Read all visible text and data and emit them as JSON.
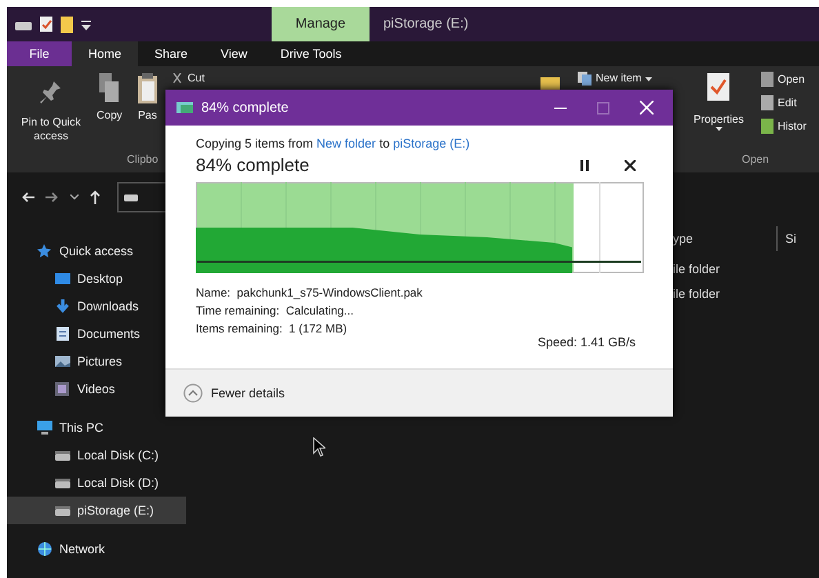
{
  "window": {
    "title": "piStorage (E:)",
    "context_tab": "Manage"
  },
  "ribbon_tabs": [
    {
      "label": "File",
      "kind": "file",
      "selected": false
    },
    {
      "label": "Home",
      "kind": "tab",
      "selected": true
    },
    {
      "label": "Share",
      "kind": "tab",
      "selected": false
    },
    {
      "label": "View",
      "kind": "tab",
      "selected": false
    },
    {
      "label": "Drive Tools",
      "kind": "tab",
      "selected": false
    }
  ],
  "ribbon": {
    "clipboard_buttons": [
      "Pin to Quick access",
      "Copy",
      "Pas"
    ],
    "cut": "Cut",
    "clipboard_group": "Clipbo",
    "new_item": "New item",
    "properties": "Properties",
    "open_items": [
      "Open",
      "Edit",
      "Histor"
    ],
    "open_group": "Open"
  },
  "sidebar": {
    "items": [
      {
        "label": "Quick access",
        "kind": "star",
        "selected": false,
        "children": [
          {
            "label": "Desktop",
            "kind": "desktop",
            "selected": false
          },
          {
            "label": "Downloads",
            "kind": "download",
            "selected": false
          },
          {
            "label": "Documents",
            "kind": "document",
            "selected": false
          },
          {
            "label": "Pictures",
            "kind": "picture",
            "selected": false
          },
          {
            "label": "Videos",
            "kind": "video",
            "selected": false
          }
        ]
      },
      {
        "label": "This PC",
        "kind": "pc",
        "selected": false,
        "children": [
          {
            "label": "Local Disk (C:)",
            "kind": "drive",
            "selected": false
          },
          {
            "label": "Local Disk (D:)",
            "kind": "drive",
            "selected": false
          },
          {
            "label": "piStorage (E:)",
            "kind": "drive",
            "selected": true
          }
        ]
      },
      {
        "label": "Network",
        "kind": "network",
        "selected": false
      }
    ]
  },
  "content": {
    "columns": [
      "ype",
      "Si"
    ],
    "rows": [
      {
        "column_1": "ile folder"
      },
      {
        "column_1": "ile folder"
      }
    ]
  },
  "dialog": {
    "title": "84% complete",
    "summary": {
      "prefix": "Copying 5 items from",
      "source": "New folder",
      "middle": "to",
      "destination": "piStorage (E:)"
    },
    "heading": "84% complete",
    "level": 0.84,
    "speed": "Speed: 1.41 GB/s",
    "details": [
      "Name:  pakchunk1_s75-WindowsClient.pak",
      "Time remaining:  Calculating...",
      "Items remaining:  1 (172 MB)"
    ],
    "details_expanded": true,
    "toggle": "Fewer details"
  }
}
